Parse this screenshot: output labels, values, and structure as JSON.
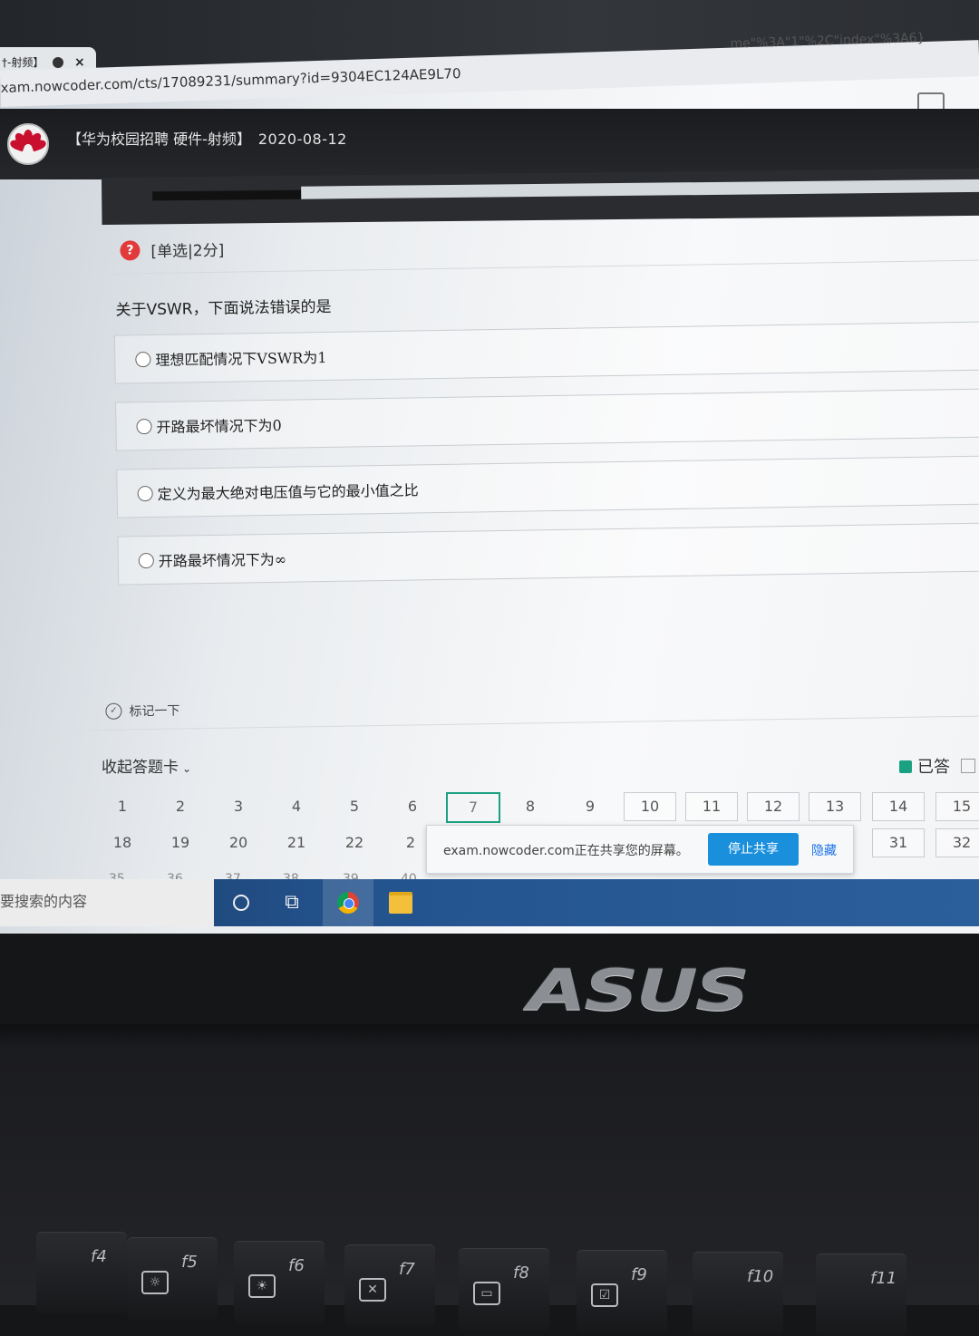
{
  "browser": {
    "tab_title": "†-射频】",
    "tab_close": "×",
    "url": "xam.nowcoder.com/cts/17089231/summary?id=9304EC124AE9L70",
    "url_tail": "me\"%3A\"1\"%2C\"index\"%3A6}"
  },
  "exam": {
    "title_prefix": "【华为校园招聘 硬件-射频】",
    "date": "2020-08-12"
  },
  "question": {
    "icon_glyph": "?",
    "type": "[单选|2分]",
    "text": "关于VSWR，下面说法错误的是",
    "options": [
      "理想匹配情况下VSWR为1",
      "开路最坏情况下为0",
      "定义为最大绝对电压值与它的最小值之比",
      "开路最坏情况下为∞"
    ],
    "mark_label": "标记一下"
  },
  "answer_card": {
    "collapse_label": "收起答题卡",
    "chevron": "⌄",
    "legend_answered": "已答",
    "row1": [
      "1",
      "2",
      "3",
      "4",
      "5",
      "6",
      "7",
      "8",
      "9",
      "10",
      "11",
      "12",
      "13",
      "14",
      "15"
    ],
    "current": "7",
    "row2_left": [
      "18",
      "19",
      "20",
      "21",
      "22",
      "2"
    ],
    "row2_right": [
      "31",
      "32"
    ],
    "row3_partial": [
      "35",
      "36",
      "37",
      "38",
      "39",
      "40"
    ]
  },
  "share_bar": {
    "message": "exam.nowcoder.com正在共享您的屏幕。",
    "stop_label": "停止共享",
    "hide_label": "隐藏"
  },
  "taskbar": {
    "search_text": "要搜索的内容",
    "taskview_glyph": "⧉"
  },
  "laptop": {
    "brand": "ASUS",
    "fkeys": [
      {
        "label": "f4",
        "glyph": ""
      },
      {
        "label": "f5",
        "glyph": "☼"
      },
      {
        "label": "f6",
        "glyph": "☀"
      },
      {
        "label": "f7",
        "glyph": "✕"
      },
      {
        "label": "f8",
        "glyph": "▭"
      },
      {
        "label": "f9",
        "glyph": "☑"
      },
      {
        "label": "f10",
        "glyph": ""
      },
      {
        "label": "f11",
        "glyph": ""
      }
    ]
  }
}
